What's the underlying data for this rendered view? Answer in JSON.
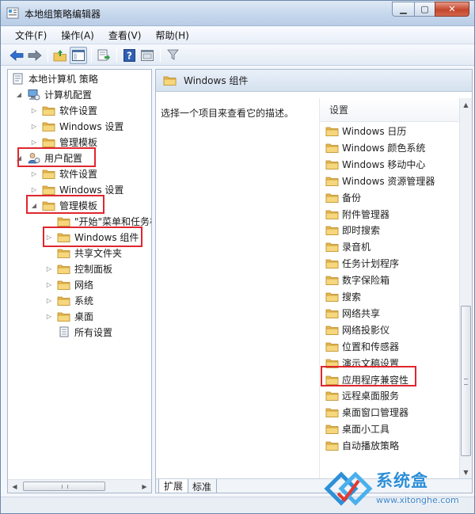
{
  "window": {
    "title": "本地组策略编辑器"
  },
  "menu": [
    "文件(F)",
    "操作(A)",
    "查看(V)",
    "帮助(H)"
  ],
  "icons": {
    "back": "back-arrow-icon",
    "forward": "forward-arrow-icon",
    "up": "up-folder-icon",
    "console_tree": "console-tree-icon",
    "export": "export-list-icon",
    "help": "help-icon",
    "properties": "properties-icon",
    "filter": "filter-icon"
  },
  "tree": {
    "root": "本地计算机 策略",
    "computer_config": "计算机配置",
    "cc_software": "软件设置",
    "cc_windows": "Windows 设置",
    "cc_admin": "管理模板",
    "user_config": "用户配置",
    "uc_software": "软件设置",
    "uc_windows": "Windows 设置",
    "uc_admin": "管理模板",
    "start_menu": "\"开始\"菜单和任务栏",
    "windows_components": "Windows 组件",
    "shared_folders": "共享文件夹",
    "control_panel": "控制面板",
    "network": "网络",
    "system": "系统",
    "desktop": "桌面",
    "all_settings": "所有设置"
  },
  "right": {
    "header": "Windows 组件",
    "description": "选择一个项目来查看它的描述。",
    "list_header": "设置",
    "items": [
      "Windows 日历",
      "Windows 颜色系统",
      "Windows 移动中心",
      "Windows 资源管理器",
      "备份",
      "附件管理器",
      "即时搜索",
      "录音机",
      "任务计划程序",
      "数字保险箱",
      "搜索",
      "网络共享",
      "网络投影仪",
      "位置和传感器",
      "演示文稿设置",
      "应用程序兼容性",
      "远程桌面服务",
      "桌面窗口管理器",
      "桌面小工具",
      "自动播放策略"
    ],
    "tabs": [
      "扩展",
      "标准"
    ]
  },
  "watermark": {
    "title": "系统盒",
    "url": "www.xitonghe.com"
  },
  "colors": {
    "highlight": "#e0262e",
    "folder": "#f1cd6e",
    "accent": "#2d8fd8"
  }
}
